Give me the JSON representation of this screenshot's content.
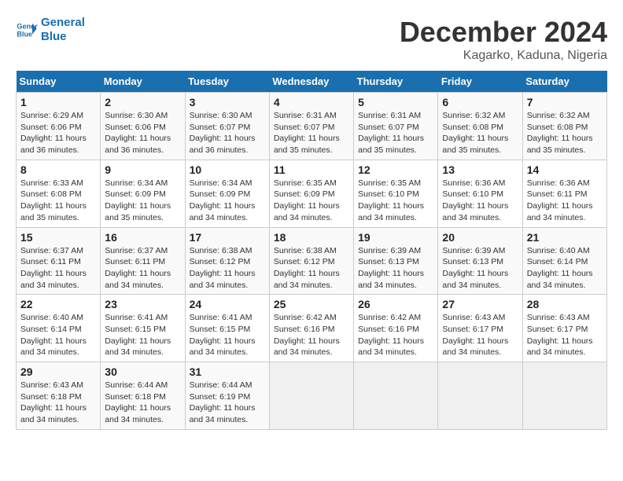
{
  "logo": {
    "line1": "General",
    "line2": "Blue"
  },
  "title": "December 2024",
  "subtitle": "Kagarko, Kaduna, Nigeria",
  "days_of_week": [
    "Sunday",
    "Monday",
    "Tuesday",
    "Wednesday",
    "Thursday",
    "Friday",
    "Saturday"
  ],
  "weeks": [
    [
      {
        "day": "1",
        "info": "Sunrise: 6:29 AM\nSunset: 6:06 PM\nDaylight: 11 hours\nand 36 minutes."
      },
      {
        "day": "2",
        "info": "Sunrise: 6:30 AM\nSunset: 6:06 PM\nDaylight: 11 hours\nand 36 minutes."
      },
      {
        "day": "3",
        "info": "Sunrise: 6:30 AM\nSunset: 6:07 PM\nDaylight: 11 hours\nand 36 minutes."
      },
      {
        "day": "4",
        "info": "Sunrise: 6:31 AM\nSunset: 6:07 PM\nDaylight: 11 hours\nand 35 minutes."
      },
      {
        "day": "5",
        "info": "Sunrise: 6:31 AM\nSunset: 6:07 PM\nDaylight: 11 hours\nand 35 minutes."
      },
      {
        "day": "6",
        "info": "Sunrise: 6:32 AM\nSunset: 6:08 PM\nDaylight: 11 hours\nand 35 minutes."
      },
      {
        "day": "7",
        "info": "Sunrise: 6:32 AM\nSunset: 6:08 PM\nDaylight: 11 hours\nand 35 minutes."
      }
    ],
    [
      {
        "day": "8",
        "info": "Sunrise: 6:33 AM\nSunset: 6:08 PM\nDaylight: 11 hours\nand 35 minutes."
      },
      {
        "day": "9",
        "info": "Sunrise: 6:34 AM\nSunset: 6:09 PM\nDaylight: 11 hours\nand 35 minutes."
      },
      {
        "day": "10",
        "info": "Sunrise: 6:34 AM\nSunset: 6:09 PM\nDaylight: 11 hours\nand 34 minutes."
      },
      {
        "day": "11",
        "info": "Sunrise: 6:35 AM\nSunset: 6:09 PM\nDaylight: 11 hours\nand 34 minutes."
      },
      {
        "day": "12",
        "info": "Sunrise: 6:35 AM\nSunset: 6:10 PM\nDaylight: 11 hours\nand 34 minutes."
      },
      {
        "day": "13",
        "info": "Sunrise: 6:36 AM\nSunset: 6:10 PM\nDaylight: 11 hours\nand 34 minutes."
      },
      {
        "day": "14",
        "info": "Sunrise: 6:36 AM\nSunset: 6:11 PM\nDaylight: 11 hours\nand 34 minutes."
      }
    ],
    [
      {
        "day": "15",
        "info": "Sunrise: 6:37 AM\nSunset: 6:11 PM\nDaylight: 11 hours\nand 34 minutes."
      },
      {
        "day": "16",
        "info": "Sunrise: 6:37 AM\nSunset: 6:11 PM\nDaylight: 11 hours\nand 34 minutes."
      },
      {
        "day": "17",
        "info": "Sunrise: 6:38 AM\nSunset: 6:12 PM\nDaylight: 11 hours\nand 34 minutes."
      },
      {
        "day": "18",
        "info": "Sunrise: 6:38 AM\nSunset: 6:12 PM\nDaylight: 11 hours\nand 34 minutes."
      },
      {
        "day": "19",
        "info": "Sunrise: 6:39 AM\nSunset: 6:13 PM\nDaylight: 11 hours\nand 34 minutes."
      },
      {
        "day": "20",
        "info": "Sunrise: 6:39 AM\nSunset: 6:13 PM\nDaylight: 11 hours\nand 34 minutes."
      },
      {
        "day": "21",
        "info": "Sunrise: 6:40 AM\nSunset: 6:14 PM\nDaylight: 11 hours\nand 34 minutes."
      }
    ],
    [
      {
        "day": "22",
        "info": "Sunrise: 6:40 AM\nSunset: 6:14 PM\nDaylight: 11 hours\nand 34 minutes."
      },
      {
        "day": "23",
        "info": "Sunrise: 6:41 AM\nSunset: 6:15 PM\nDaylight: 11 hours\nand 34 minutes."
      },
      {
        "day": "24",
        "info": "Sunrise: 6:41 AM\nSunset: 6:15 PM\nDaylight: 11 hours\nand 34 minutes."
      },
      {
        "day": "25",
        "info": "Sunrise: 6:42 AM\nSunset: 6:16 PM\nDaylight: 11 hours\nand 34 minutes."
      },
      {
        "day": "26",
        "info": "Sunrise: 6:42 AM\nSunset: 6:16 PM\nDaylight: 11 hours\nand 34 minutes."
      },
      {
        "day": "27",
        "info": "Sunrise: 6:43 AM\nSunset: 6:17 PM\nDaylight: 11 hours\nand 34 minutes."
      },
      {
        "day": "28",
        "info": "Sunrise: 6:43 AM\nSunset: 6:17 PM\nDaylight: 11 hours\nand 34 minutes."
      }
    ],
    [
      {
        "day": "29",
        "info": "Sunrise: 6:43 AM\nSunset: 6:18 PM\nDaylight: 11 hours\nand 34 minutes."
      },
      {
        "day": "30",
        "info": "Sunrise: 6:44 AM\nSunset: 6:18 PM\nDaylight: 11 hours\nand 34 minutes."
      },
      {
        "day": "31",
        "info": "Sunrise: 6:44 AM\nSunset: 6:19 PM\nDaylight: 11 hours\nand 34 minutes."
      },
      {
        "day": "",
        "info": ""
      },
      {
        "day": "",
        "info": ""
      },
      {
        "day": "",
        "info": ""
      },
      {
        "day": "",
        "info": ""
      }
    ]
  ]
}
